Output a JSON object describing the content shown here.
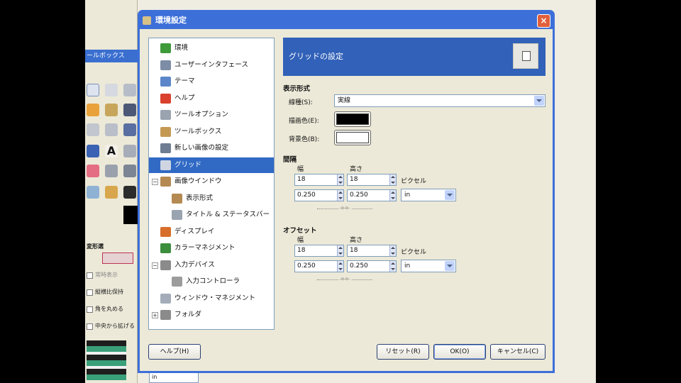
{
  "toolbox": {
    "title": "ールボックス",
    "section_label": "変形選",
    "options": [
      "常時表示",
      "縦横比保持",
      "角を丸める",
      "中央から拡げる"
    ],
    "unit_value": "in"
  },
  "dialog": {
    "title": "環境設定",
    "close_glyph": "×"
  },
  "tree": {
    "items": [
      {
        "label": "環境",
        "icon_color": "#3f9a3a"
      },
      {
        "label": "ユーザーインタフェース",
        "icon_color": "#7d8da6"
      },
      {
        "label": "テーマ",
        "icon_color": "#5b86c9"
      },
      {
        "label": "ヘルプ",
        "icon_color": "#d9412c"
      },
      {
        "label": "ツールオプション",
        "icon_color": "#9aa3b0"
      },
      {
        "label": "ツールボックス",
        "icon_color": "#c49a53"
      },
      {
        "label": "新しい画像の設定",
        "icon_color": "#6e7d93"
      },
      {
        "label": "グリッド",
        "icon_color": "#cfd6e2"
      },
      {
        "label": "画像ウインドウ",
        "icon_color": "#b48a52"
      },
      {
        "label": "表示形式",
        "icon_color": "#b48a52"
      },
      {
        "label": "タイトル & ステータスバー",
        "icon_color": "#9aa3b0"
      },
      {
        "label": "ディスプレイ",
        "icon_color": "#d76f2a"
      },
      {
        "label": "カラーマネジメント",
        "icon_color": "#3c8d3c"
      },
      {
        "label": "入力デバイス",
        "icon_color": "#8b8b8b"
      },
      {
        "label": "入力コントローラ",
        "icon_color": "#9c9c9c"
      },
      {
        "label": "ウィンドウ・マネジメント",
        "icon_color": "#a4acb9"
      },
      {
        "label": "フォルダ",
        "icon_color": "#8b8b8b"
      }
    ],
    "expander_minus": "−",
    "expander_plus": "+"
  },
  "header": {
    "title": "グリッドの設定"
  },
  "appearance": {
    "section": "表示形式",
    "line_style_label": "線種(S):",
    "line_style_value": "実線",
    "fg_label": "描画色(E):",
    "fg_color": "#000000",
    "bg_label": "背景色(B):",
    "bg_color": "#ffffff"
  },
  "spacing": {
    "section": "間隔",
    "width_label": "幅",
    "height_label": "高さ",
    "px_width": "18",
    "px_height": "18",
    "px_unit": "ピクセル",
    "in_width": "0.250",
    "in_height": "0.250",
    "unit": "in",
    "chain_text": "-o-o-"
  },
  "offset": {
    "section": "オフセット",
    "width_label": "幅",
    "height_label": "高さ",
    "px_width": "18",
    "px_height": "18",
    "px_unit": "ピクセル",
    "in_width": "0.250",
    "in_height": "0.250",
    "unit": "in",
    "chain_text": "-o-o-"
  },
  "buttons": {
    "help": "ヘルプ(H)",
    "reset": "リセット(R)",
    "ok": "OK(O)",
    "cancel": "キャンセル(C)"
  }
}
